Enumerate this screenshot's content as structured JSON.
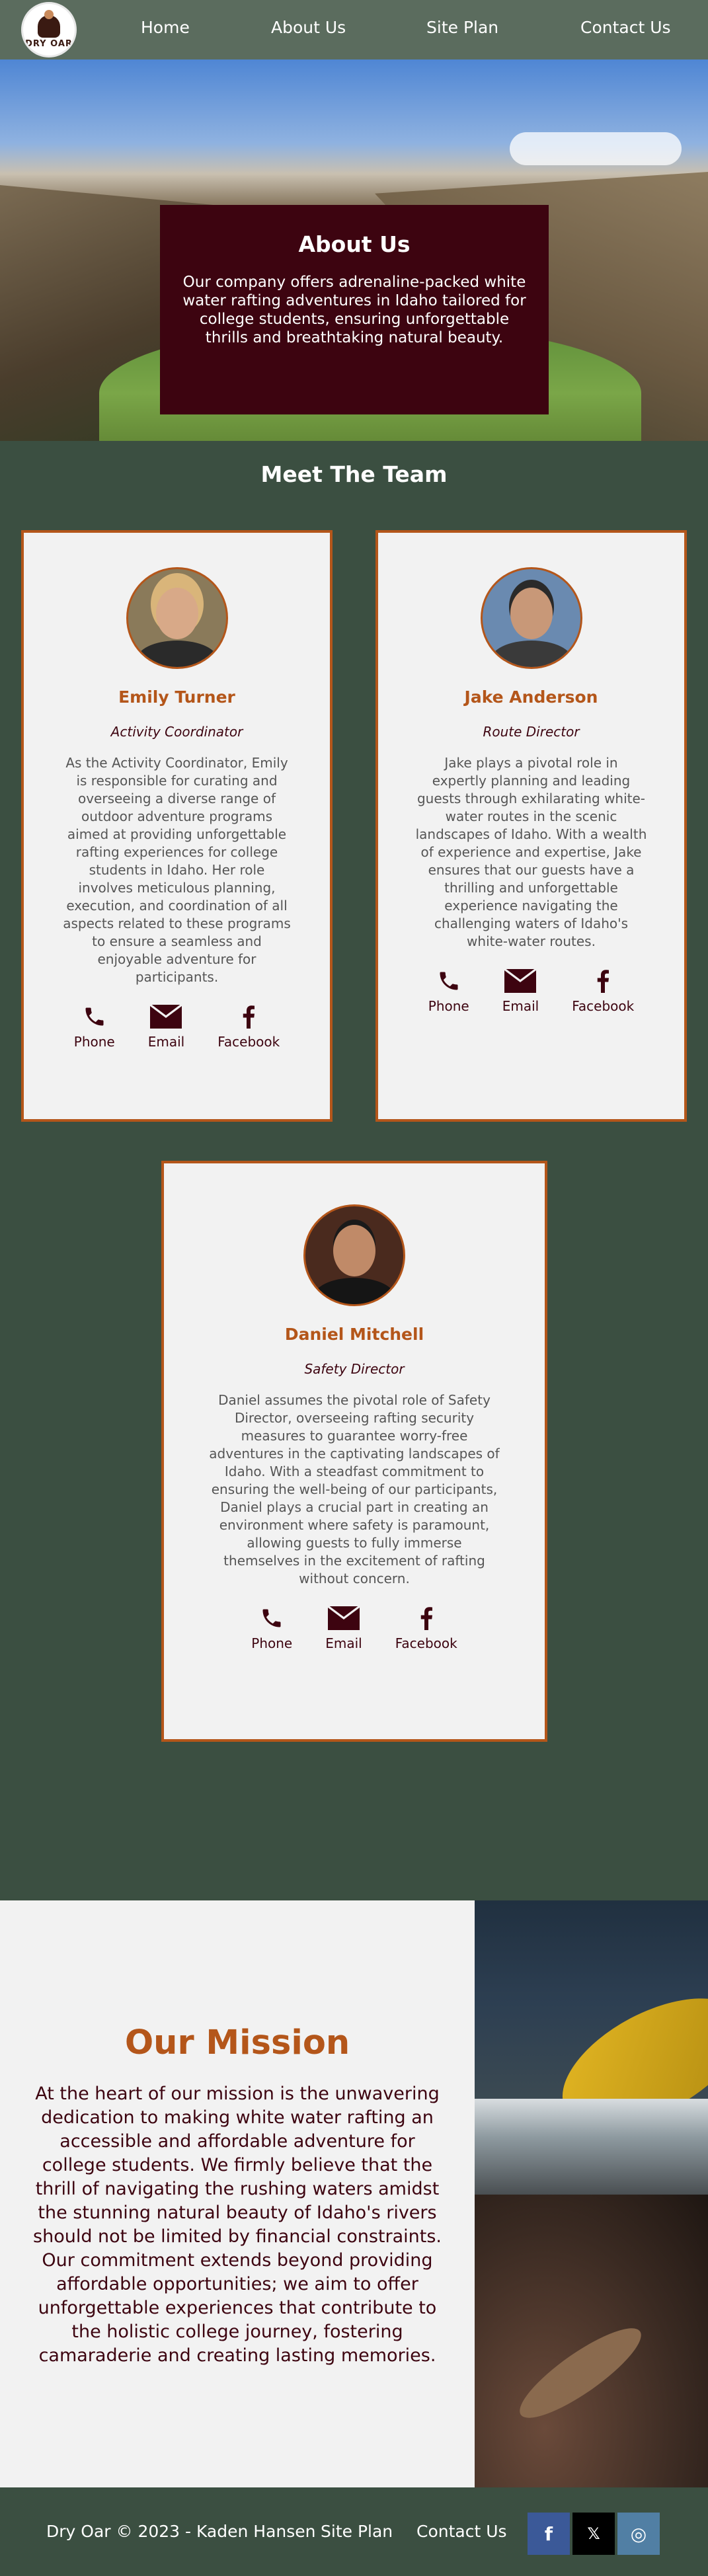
{
  "nav": {
    "logo_text": "DRY OAR",
    "links": [
      "Home",
      "About Us",
      "Site Plan",
      "Contact Us"
    ]
  },
  "hero": {
    "title": "About Us",
    "text": "Our company offers adrenaline-packed white water rafting adventures in Idaho tailored for college students, ensuring unforgettable thrills and breathtaking natural beauty."
  },
  "team": {
    "heading": "Meet The Team",
    "members": [
      {
        "name": "Emily Turner",
        "role": "Activity Coordinator",
        "bio": "As the Activity Coordinator, Emily is responsible for curating and overseeing a diverse range of outdoor adventure programs aimed at providing unforgettable rafting experiences for college students in Idaho. Her role involves meticulous planning, execution, and coordination of all aspects related to these programs to ensure a seamless and enjoyable adventure for participants.",
        "avatar_colors": {
          "bg": "#8a7a5a",
          "hair": "#d9b57a",
          "body": "#2a2a2a"
        }
      },
      {
        "name": "Jake Anderson",
        "role": "Route Director",
        "bio": "Jake plays a pivotal role in expertly planning and leading guests through exhilarating white-water routes in the scenic landscapes of Idaho. With a wealth of experience and expertise, Jake ensures that our guests have a thrilling and unforgettable experience navigating the challenging waters of Idaho's white-water routes.",
        "avatar_colors": {
          "bg": "#6a8ab0",
          "hair": "#2a2a2a",
          "body": "#3a3a3a"
        }
      },
      {
        "name": "Daniel Mitchell",
        "role": "Safety Director",
        "bio": "Daniel assumes the pivotal role of Safety Director, overseeing rafting security measures to guarantee worry-free adventures in the captivating landscapes of Idaho. With a steadfast commitment to ensuring the well-being of our participants, Daniel plays a crucial part in creating an environment where safety is paramount, allowing guests to fully immerse themselves in the excitement of rafting without concern.",
        "avatar_colors": {
          "bg": "#4a2a1e",
          "hair": "#1a1a1a",
          "body": "#151515"
        }
      }
    ],
    "contact_labels": {
      "phone": "Phone",
      "email": "Email",
      "facebook": "Facebook"
    }
  },
  "mission": {
    "title": "Our Mission",
    "text": "At the heart of our mission is the unwavering dedication to making white water rafting an accessible and affordable adventure for college students. We firmly believe that the thrill of navigating the rushing waters amidst the stunning natural beauty of Idaho's rivers should not be limited by financial constraints. Our commitment extends beyond providing affordable opportunities; we aim to offer unforgettable experiences that contribute to the holistic college journey, fostering camaraderie and creating lasting memories."
  },
  "footer": {
    "copyright": "Dry Oar © 2023 - Kaden Hansen",
    "links": [
      "Site Plan",
      "Contact Us"
    ],
    "social": [
      {
        "name": "facebook-icon",
        "glyph": "f",
        "color": "#3b5998"
      },
      {
        "name": "x-icon",
        "glyph": "𝕏",
        "color": "#000000"
      },
      {
        "name": "instagram-icon",
        "glyph": "◎",
        "color": "#517fa4"
      }
    ]
  },
  "colors": {
    "accent": "#b4561a",
    "dark_maroon": "#3d0410",
    "green_bg": "#3b4f41",
    "nav_bg": "#5b6c5e",
    "card_bg": "#f2f2f2"
  }
}
